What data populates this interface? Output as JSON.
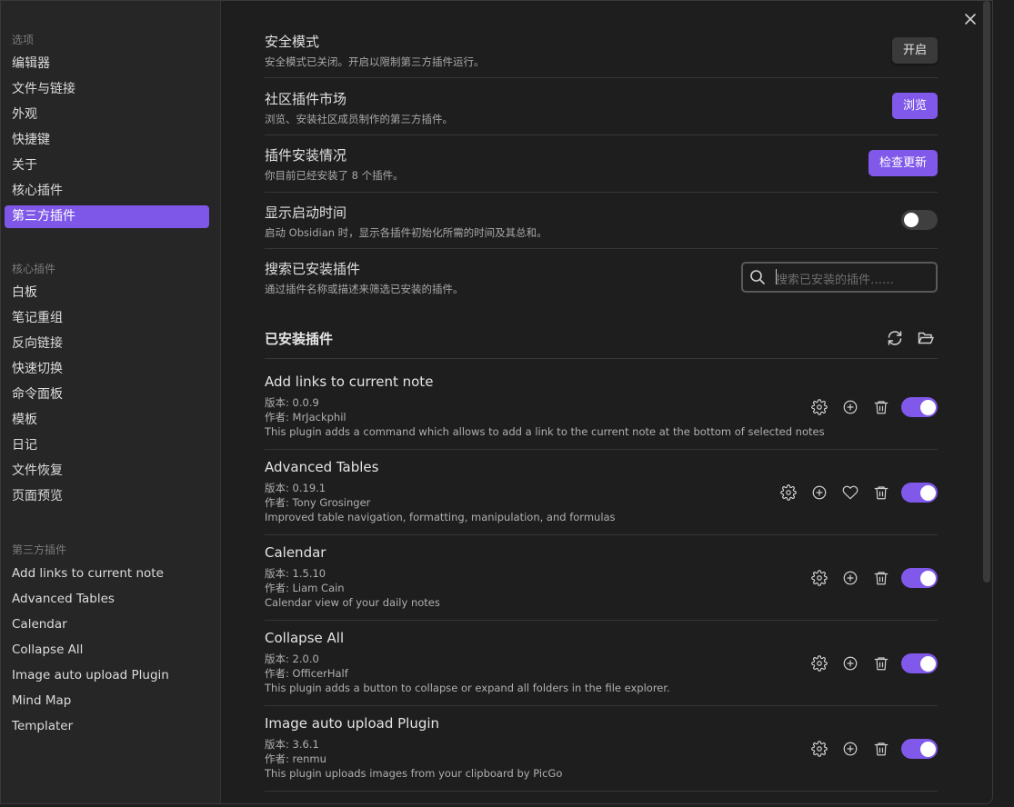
{
  "sidebar": {
    "options_heading": "选项",
    "options": [
      "编辑器",
      "文件与链接",
      "外观",
      "快捷键",
      "关于",
      "核心插件",
      "第三方插件"
    ],
    "core_heading": "核心插件",
    "core": [
      "白板",
      "笔记重组",
      "反向链接",
      "快速切换",
      "命令面板",
      "模板",
      "日记",
      "文件恢复",
      "页面预览"
    ],
    "third_heading": "第三方插件",
    "third": [
      "Add links to current note",
      "Advanced Tables",
      "Calendar",
      "Collapse All",
      "Image auto upload Plugin",
      "Mind Map",
      "Templater"
    ]
  },
  "settings": {
    "safe_mode": {
      "name": "安全模式",
      "desc": "安全模式已关闭。开启以限制第三方插件运行。",
      "button": "开启"
    },
    "community": {
      "name": "社区插件市场",
      "desc": "浏览、安装社区成员制作的第三方插件。",
      "button": "浏览"
    },
    "install_status": {
      "name": "插件安装情况",
      "desc": "你目前已经安装了 8 个插件。",
      "button": "检查更新"
    },
    "startup_time": {
      "name": "显示启动时间",
      "desc": "启动 Obsidian 时，显示各插件初始化所需的时间及其总和。",
      "enabled": false
    },
    "search": {
      "name": "搜索已安装插件",
      "desc": "通过插件名称或描述来筛选已安装的插件。",
      "placeholder": "搜索已安装的插件……"
    }
  },
  "installed_heading": "已安装插件",
  "plugins": [
    {
      "name": "Add links to current note",
      "version": "版本: 0.0.9",
      "author": "作者:  MrJackphil",
      "desc": "This plugin adds a command which allows to add a link to the current note at the bottom of selected notes",
      "enabled": true,
      "heart": false
    },
    {
      "name": "Advanced Tables",
      "version": "版本: 0.19.1",
      "author": "作者:  Tony Grosinger",
      "desc": "Improved table navigation, formatting, manipulation, and formulas",
      "enabled": true,
      "heart": true
    },
    {
      "name": "Calendar",
      "version": "版本: 1.5.10",
      "author": "作者:  Liam Cain",
      "desc": "Calendar view of your daily notes",
      "enabled": true,
      "heart": false
    },
    {
      "name": "Collapse All",
      "version": "版本: 2.0.0",
      "author": "作者:  OfficerHalf",
      "desc": "This plugin adds a button to collapse or expand all folders in the file explorer.",
      "enabled": true,
      "heart": false
    },
    {
      "name": "Image auto upload Plugin",
      "version": "版本: 3.6.1",
      "author": "作者:  renmu",
      "desc": "This plugin uploads images from your clipboard by PicGo",
      "enabled": true,
      "heart": false
    }
  ],
  "icons": {
    "close": "close-icon",
    "refresh": "refresh-icon",
    "folder": "folder-open-icon",
    "gear": "gear-icon",
    "plus": "plus-circle-icon",
    "heart": "heart-icon",
    "trash": "trash-icon",
    "search": "search-icon"
  },
  "colors": {
    "accent": "#8058ea",
    "background": "#1e1e1e",
    "sidebar": "#262626"
  }
}
